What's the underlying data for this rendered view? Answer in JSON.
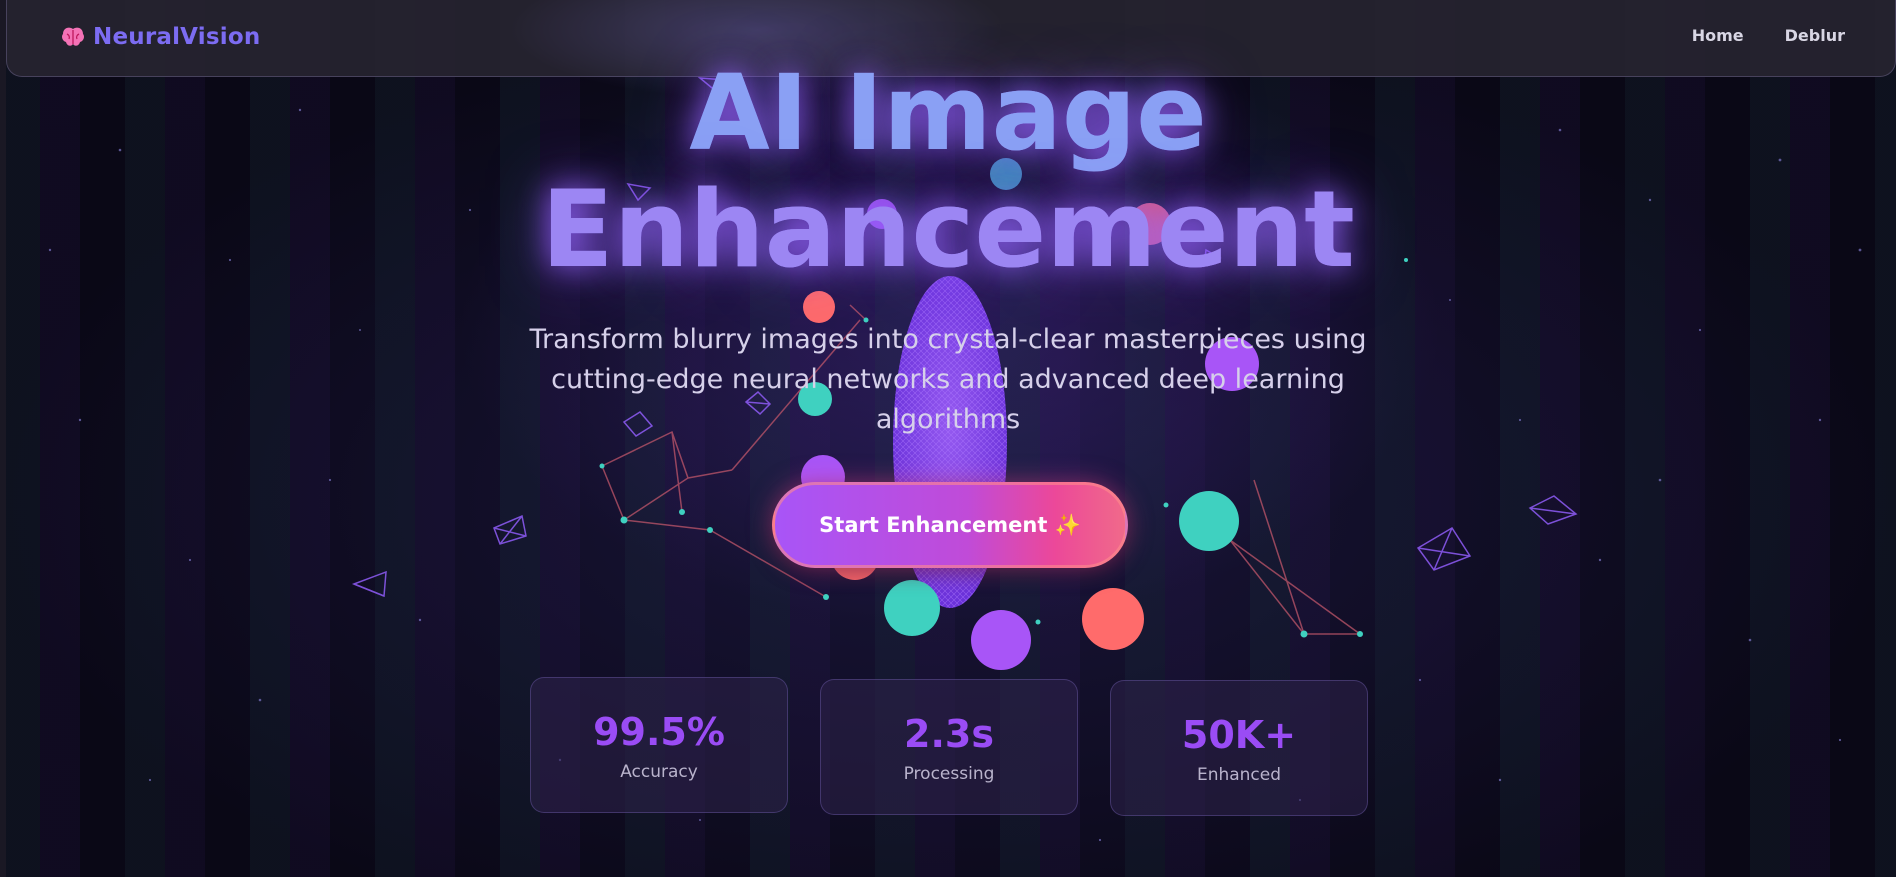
{
  "navbar": {
    "brand": "NeuralVision",
    "brand_icon": "brain-icon",
    "links": [
      {
        "label": "Home"
      },
      {
        "label": "Deblur"
      }
    ]
  },
  "hero": {
    "title_line1": "AI Image",
    "title_line2": "Enhancement",
    "subtitle": "Transform blurry images into crystal-clear masterpieces using cutting-edge neural networks and advanced deep learning algorithms",
    "cta_label": "Start Enhancement ✨"
  },
  "stats": [
    {
      "value": "99.5%",
      "label": "Accuracy"
    },
    {
      "value": "2.3s",
      "label": "Processing"
    },
    {
      "value": "50K+",
      "label": "Enhanced"
    }
  ],
  "colors": {
    "accent_purple": "#a855f7",
    "accent_pink": "#ec4899",
    "teal": "#3fd1c0",
    "coral": "#ff6b6b",
    "brand_text": "#7c6cf2"
  }
}
